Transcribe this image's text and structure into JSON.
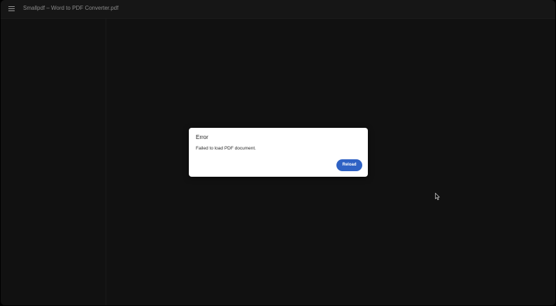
{
  "toolbar": {
    "menu_icon": "hamburger-menu-icon",
    "title": "Smallpdf – Word to PDF Converter.pdf"
  },
  "dialog": {
    "title": "Error",
    "message": "Failed to load PDF document.",
    "reload_label": "Reload"
  },
  "colors": {
    "background": "#111111",
    "toolbar": "#161616",
    "dialog_background": "#ffffff",
    "accent": "#2f62c4"
  },
  "cursor_icon": "mouse-pointer-icon"
}
